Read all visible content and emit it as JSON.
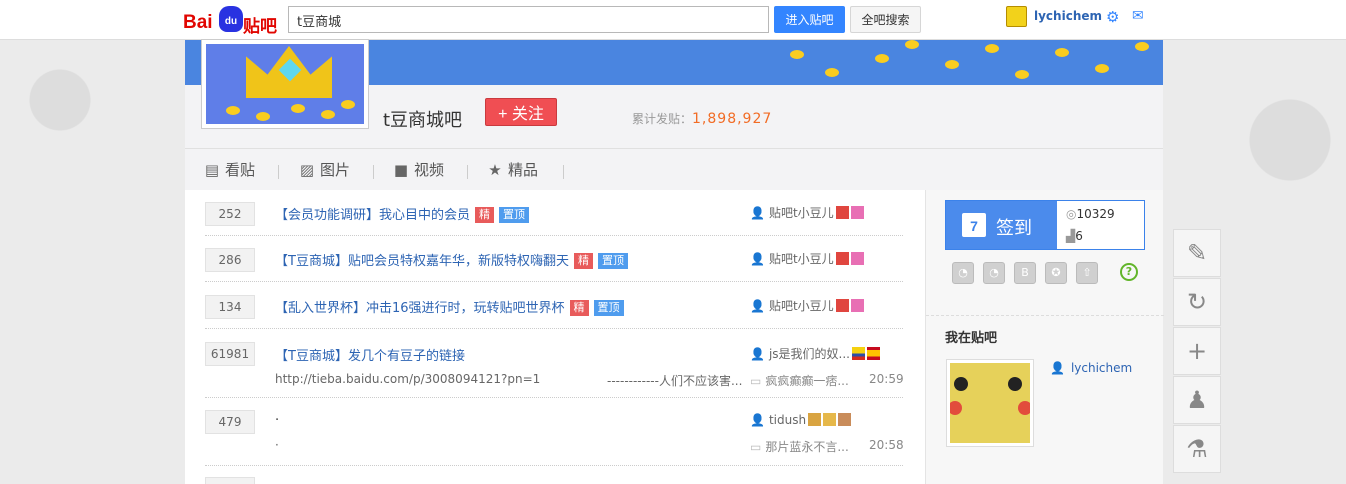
{
  "topbar": {
    "logo_bai": "Bai",
    "logo_du": "du",
    "logo_tieba": "贴吧",
    "search_value": "t豆商城",
    "enter_button": "进入贴吧",
    "search_all_button": "全吧搜索",
    "username": "lychichem",
    "settings_icon": "gear-icon",
    "mail_icon": "mail-icon"
  },
  "forum": {
    "name": "t豆商城吧",
    "follow_label": "+ 关注",
    "posts_label": "累计发贴：",
    "posts_count": "1,898,927"
  },
  "tabs": [
    {
      "label": "看贴",
      "icon": "document-icon"
    },
    {
      "label": "图片",
      "icon": "image-icon"
    },
    {
      "label": "视频",
      "icon": "video-icon"
    },
    {
      "label": "精品",
      "icon": "star-icon"
    }
  ],
  "threads": [
    {
      "reply_count": "252",
      "title": "【会员功能调研】我心目中的会员",
      "tags": [
        "精",
        "置顶"
      ],
      "author": "贴吧t小豆儿"
    },
    {
      "reply_count": "286",
      "title": "【T豆商城】贴吧会员特权嘉年华，新版特权嗨翻天",
      "tags": [
        "精",
        "置顶"
      ],
      "author": "贴吧t小豆儿"
    },
    {
      "reply_count": "134",
      "title": "【乱入世界杯】冲击16强进行时，玩转贴吧世界杯",
      "tags": [
        "精",
        "置顶"
      ],
      "author": "贴吧t小豆儿"
    },
    {
      "reply_count": "61981",
      "title": "【T豆商城】发几个有豆子的链接",
      "abstract": "http://tieba.baidu.com/p/3008094121?pn=1",
      "abstract2": "------------人们不应该害...",
      "author": "js是我们的奴...",
      "last_reply": "疯疯癫癫一痞...",
      "time": "20:59"
    },
    {
      "reply_count": "479",
      "title": "·",
      "abstract": "·",
      "author": "tidush",
      "last_reply": "那片蓝永不言...",
      "time": "20:58"
    }
  ],
  "sidebar": {
    "sign_day": "7",
    "sign_label": "签到",
    "rank_value": "10329",
    "level_value": "6",
    "help_label": "?",
    "my_tieba_label": "我在贴吧",
    "my_name": "lychichem"
  },
  "tools": [
    "edit-icon",
    "refresh-icon",
    "plus-icon",
    "user-icon",
    "flask-icon"
  ]
}
